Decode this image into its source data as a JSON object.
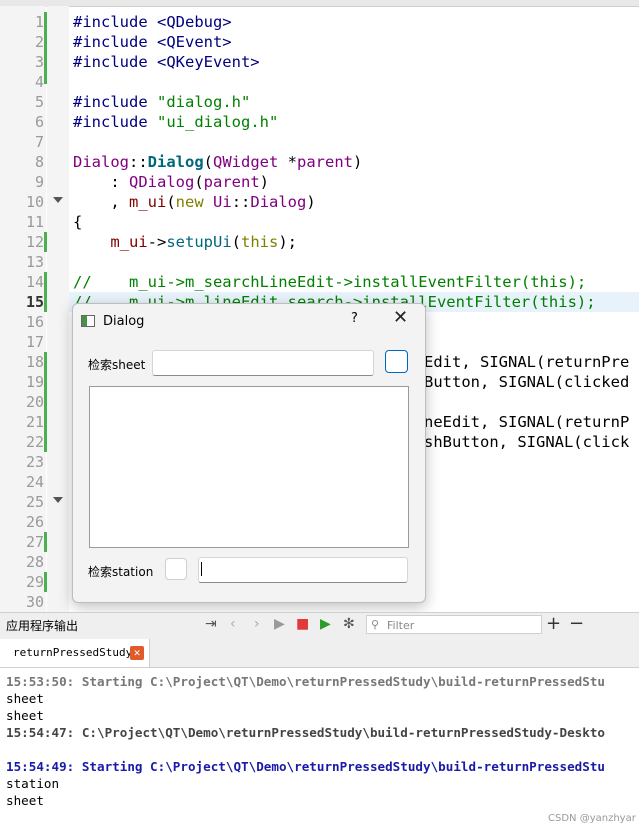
{
  "editor": {
    "lines": [
      {
        "no": "1",
        "text": "#include <QDebug>"
      },
      {
        "no": "2",
        "text": "#include <QEvent>"
      },
      {
        "no": "3",
        "text": "#include <QKeyEvent>"
      },
      {
        "no": "4",
        "text": ""
      },
      {
        "no": "5",
        "text": "#include \"dialog.h\""
      },
      {
        "no": "6",
        "text": "#include \"ui_dialog.h\""
      },
      {
        "no": "7",
        "text": ""
      },
      {
        "no": "8",
        "text": "Dialog::Dialog(QWidget *parent)"
      },
      {
        "no": "9",
        "text": "    : QDialog(parent)"
      },
      {
        "no": "10",
        "text": "    , m_ui(new Ui::Dialog)"
      },
      {
        "no": "11",
        "text": "{"
      },
      {
        "no": "12",
        "text": "    m_ui->setupUi(this);"
      },
      {
        "no": "13",
        "text": ""
      },
      {
        "no": "14",
        "text": "//    m_ui->m_searchLineEdit->installEventFilter(this);"
      },
      {
        "no": "15",
        "text": "//    m_ui->m_lineEdit_search->installEventFilter(this);"
      },
      {
        "no": "16",
        "text": ""
      },
      {
        "no": "17",
        "text": ""
      },
      {
        "no": "18",
        "text": ""
      },
      {
        "no": "19",
        "text": ""
      },
      {
        "no": "20",
        "text": ""
      },
      {
        "no": "21",
        "text": ""
      },
      {
        "no": "22",
        "text": ""
      },
      {
        "no": "23",
        "text": ""
      },
      {
        "no": "24",
        "text": ""
      },
      {
        "no": "25",
        "text": ""
      },
      {
        "no": "26",
        "text": ""
      },
      {
        "no": "27",
        "text": ""
      },
      {
        "no": "28",
        "text": ""
      },
      {
        "no": "29",
        "text": ""
      },
      {
        "no": "30",
        "text": ""
      }
    ],
    "visible_fragments": {
      "l18": "Edit, SIGNAL(returnPre",
      "l19": "Button, SIGNAL(clicked",
      "l21": "neEdit, SIGNAL(returnP",
      "l22": "shButton, SIGNAL(click"
    }
  },
  "dialog": {
    "title": "Dialog",
    "help": "?",
    "close": "✕",
    "sheet_label": "检索sheet",
    "station_label": "检索station",
    "sheet_input_value": "",
    "station_input_value": ""
  },
  "output_panel": {
    "title": "应用程序输出",
    "filter_placeholder": "Filter",
    "tab_label": "returnPressedStudy",
    "tab_close": "✕",
    "lines": [
      {
        "style": "gray",
        "text": "15:53:50: Starting C:\\Project\\QT\\Demo\\returnPressedStudy\\build-returnPressedStu"
      },
      {
        "style": "plain",
        "text": "sheet"
      },
      {
        "style": "plain",
        "text": "sheet"
      },
      {
        "style": "dark",
        "text": "15:54:47: C:\\Project\\QT\\Demo\\returnPressedStudy\\build-returnPressedStudy-Deskto"
      },
      {
        "style": "plain",
        "text": ""
      },
      {
        "style": "blue",
        "text": "15:54:49: Starting C:\\Project\\QT\\Demo\\returnPressedStudy\\build-returnPressedStu"
      },
      {
        "style": "plain",
        "text": "station"
      },
      {
        "style": "plain",
        "text": "sheet"
      }
    ]
  },
  "watermark": "CSDN @yanzhyar",
  "icons": [
    "fold-arrow-icon",
    "dialog-app-icon",
    "help-icon",
    "close-icon",
    "filter-icon",
    "run-icon",
    "stop-icon",
    "debug-run-icon",
    "settings-icon",
    "plus-icon",
    "minus-icon",
    "nav-prev-icon",
    "nav-next-icon",
    "wrap-icon"
  ]
}
